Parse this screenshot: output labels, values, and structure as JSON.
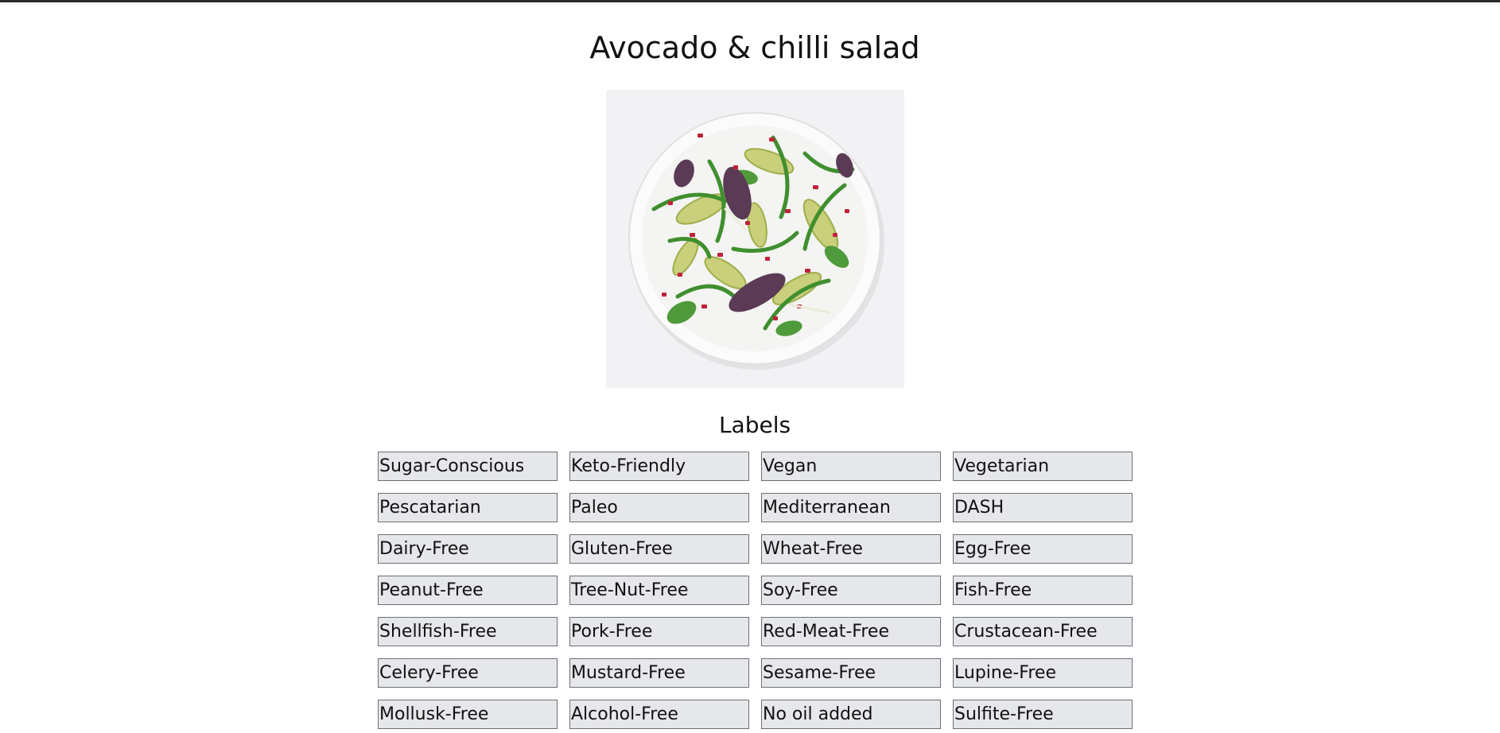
{
  "recipe": {
    "title": "Avocado & chilli salad",
    "image_alt": "Avocado & chilli salad"
  },
  "labels": {
    "heading": "Labels",
    "items": [
      "Sugar-Conscious",
      "Keto-Friendly",
      "Vegan",
      "Vegetarian",
      "Pescatarian",
      "Paleo",
      "Mediterranean",
      "DASH",
      "Dairy-Free",
      "Gluten-Free",
      "Wheat-Free",
      "Egg-Free",
      "Peanut-Free",
      "Tree-Nut-Free",
      "Soy-Free",
      "Fish-Free",
      "Shellfish-Free",
      "Pork-Free",
      "Red-Meat-Free",
      "Crustacean-Free",
      "Celery-Free",
      "Mustard-Free",
      "Sesame-Free",
      "Lupine-Free",
      "Mollusk-Free",
      "Alcohol-Free",
      "No oil added",
      "Sulfite-Free"
    ]
  }
}
